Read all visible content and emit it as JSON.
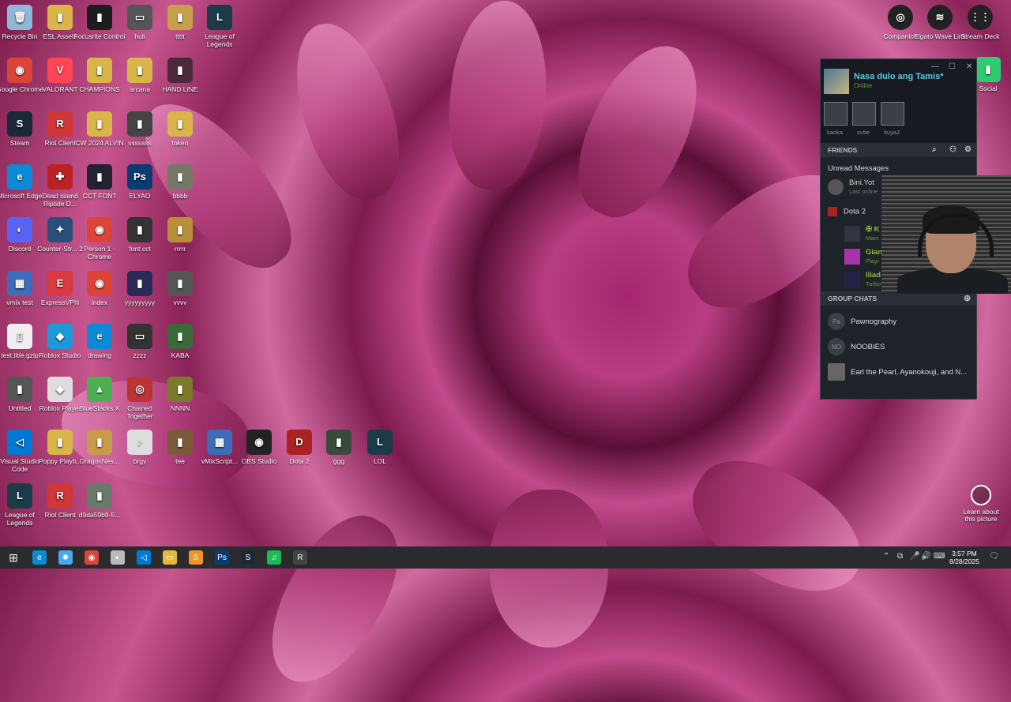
{
  "desktop": {
    "icons": [
      {
        "label": "Recycle Bin",
        "color": "#8fb7d8",
        "glyph": "🗑"
      },
      {
        "label": "ESL Assets",
        "color": "#d9b54a",
        "glyph": "▮"
      },
      {
        "label": "Focusrite Control",
        "color": "#1d1d1d",
        "glyph": "▮"
      },
      {
        "label": "huli",
        "color": "#555",
        "glyph": "▭"
      },
      {
        "label": "ttttt",
        "color": "#c9a04a",
        "glyph": "▮"
      },
      {
        "label": "League of Legends",
        "color": "#1b3b4a",
        "glyph": "L"
      },
      {
        "label": "Google Chrome",
        "color": "#db4437",
        "glyph": "◉"
      },
      {
        "label": "VALORANT",
        "color": "#ff4655",
        "glyph": "V"
      },
      {
        "label": "CHAMPIONS",
        "color": "#d9b54a",
        "glyph": "▮"
      },
      {
        "label": "arcana",
        "color": "#d9b54a",
        "glyph": "▮"
      },
      {
        "label": "HAND LINE",
        "color": "#4a2a3a",
        "glyph": "▮"
      },
      {
        "label": "Steam",
        "color": "#1b2838",
        "glyph": "S"
      },
      {
        "label": "Riot Client",
        "color": "#d13639",
        "glyph": "R"
      },
      {
        "label": "CW 2024 ALVIN",
        "color": "#d9b54a",
        "glyph": "▮"
      },
      {
        "label": "sssssss",
        "color": "#444",
        "glyph": "▮"
      },
      {
        "label": "token",
        "color": "#d9b54a",
        "glyph": "▮"
      },
      {
        "label": "Microsoft Edge",
        "color": "#0c8ad6",
        "glyph": "e"
      },
      {
        "label": "Dead Island Riptide D...",
        "color": "#b22",
        "glyph": "✚"
      },
      {
        "label": "CCT FONT",
        "color": "#223",
        "glyph": "▮"
      },
      {
        "label": "ELYAO",
        "color": "#0b3b73",
        "glyph": "Ps"
      },
      {
        "label": "bbbb",
        "color": "#776",
        "glyph": "▮"
      },
      {
        "label": "Discord",
        "color": "#5865f2",
        "glyph": "◐"
      },
      {
        "label": "Counter-Str... 2",
        "color": "#2a4f7a",
        "glyph": "✦"
      },
      {
        "label": "Person 1 - Chrome",
        "color": "#db4437",
        "glyph": "◉"
      },
      {
        "label": "font cct",
        "color": "#333",
        "glyph": "▮"
      },
      {
        "label": "rrrrr",
        "color": "#b8903a",
        "glyph": "▮"
      },
      {
        "label": "vmix test",
        "color": "#3b6db8",
        "glyph": "▦"
      },
      {
        "label": "ExpressVPN",
        "color": "#da3940",
        "glyph": "E"
      },
      {
        "label": "index",
        "color": "#db4437",
        "glyph": "◉"
      },
      {
        "label": "yyyyyyyyy",
        "color": "#2a2a5a",
        "glyph": "▮"
      },
      {
        "label": "vvvv",
        "color": "#555",
        "glyph": "▮"
      },
      {
        "label": "test.title.gzip",
        "color": "#eee",
        "glyph": "▯"
      },
      {
        "label": "Roblox Studio",
        "color": "#1a9ad9",
        "glyph": "◆"
      },
      {
        "label": "drawing",
        "color": "#0c8ad6",
        "glyph": "e"
      },
      {
        "label": "zzzz",
        "color": "#333",
        "glyph": "▭"
      },
      {
        "label": "KABA",
        "color": "#3a6a3a",
        "glyph": "▮"
      },
      {
        "label": "Untitled",
        "color": "#555",
        "glyph": "▮"
      },
      {
        "label": "Roblox Player",
        "color": "#ddd",
        "glyph": "◆"
      },
      {
        "label": "BlueStacks X",
        "color": "#4caf50",
        "glyph": "▲"
      },
      {
        "label": "Chained Together",
        "color": "#b33",
        "glyph": "◎"
      },
      {
        "label": "NNNN",
        "color": "#7a7a2a",
        "glyph": "▮"
      },
      {
        "label": "Visual Studio Code",
        "color": "#0078d4",
        "glyph": "◁"
      },
      {
        "label": "Poppy Playti...",
        "color": "#d9b54a",
        "glyph": "▮"
      },
      {
        "label": "DragonNes...",
        "color": "#c89a4a",
        "glyph": "▮"
      },
      {
        "label": "brgy",
        "color": "#ddd",
        "glyph": "♪"
      },
      {
        "label": "tee",
        "color": "#7a5a3a",
        "glyph": "▮"
      },
      {
        "label": "vMixScript...",
        "color": "#3b6db8",
        "glyph": "▦"
      },
      {
        "label": "OBS Studio",
        "color": "#222",
        "glyph": "◉"
      },
      {
        "label": "Dota 2",
        "color": "#a22",
        "glyph": "D"
      },
      {
        "label": "ggg",
        "color": "#3a4a3a",
        "glyph": "▮"
      },
      {
        "label": "LOL",
        "color": "#1b3b4a",
        "glyph": "L"
      },
      {
        "label": "League of Legends",
        "color": "#1b3b4a",
        "glyph": "L"
      },
      {
        "label": "Riot Client",
        "color": "#d13639",
        "glyph": "R"
      },
      {
        "label": "d9da59b9-5...",
        "color": "#6a7a6a",
        "glyph": "▮"
      }
    ],
    "right_icons": [
      {
        "label": "Companion",
        "glyph": "◎"
      },
      {
        "label": "Elgato Wave Link",
        "glyph": "≋"
      },
      {
        "label": "Stream Deck",
        "glyph": "⋮⋮"
      },
      {
        "label": "Social",
        "glyph": "▮"
      }
    ],
    "learn_label": "Learn about this picture"
  },
  "friends": {
    "username": "Nasa dulo ang Tamis*",
    "status": "Online",
    "window_buttons": [
      "—",
      "☐",
      "✕"
    ],
    "party": [
      "kaoka",
      "cutie",
      "kuyaJ"
    ],
    "friends_header": "FRIENDS",
    "unread_label": "Unread Messages",
    "unread_friend": {
      "name": "Bini.Yot",
      "sub": "Last online"
    },
    "game_group": "Dota 2",
    "game_friends": [
      {
        "name": "✠ K",
        "sub": "Main"
      },
      {
        "name": "Gian",
        "sub": "Playi"
      },
      {
        "name": "Iliad",
        "sub": "Turbo"
      }
    ],
    "group_chats_header": "GROUP CHATS",
    "group_chats": [
      {
        "initials": "Pa",
        "name": "Pawnography"
      },
      {
        "initials": "NO",
        "name": "NOOBIES"
      },
      {
        "initials": "",
        "name": "Earl the Pearl, Ayanokouji, and N..."
      }
    ]
  },
  "taskbar": {
    "apps": [
      {
        "name": "edge",
        "glyph": "e",
        "color": "#0c8ad6"
      },
      {
        "name": "copilot",
        "glyph": "✺",
        "color": "#4aa8e8"
      },
      {
        "name": "chrome",
        "glyph": "◉",
        "color": "#db4437"
      },
      {
        "name": "app-white",
        "glyph": "◐",
        "color": "#bbb"
      },
      {
        "name": "vscode",
        "glyph": "◁",
        "color": "#0078d4"
      },
      {
        "name": "explorer",
        "glyph": "▭",
        "color": "#e8b83a"
      },
      {
        "name": "sublime",
        "glyph": "S",
        "color": "#f0932b"
      },
      {
        "name": "photoshop",
        "glyph": "Ps",
        "color": "#0b3b73"
      },
      {
        "name": "steam",
        "glyph": "S",
        "color": "#1b2838"
      },
      {
        "name": "spotify",
        "glyph": "♫",
        "color": "#1db954"
      },
      {
        "name": "riot",
        "glyph": "R",
        "color": "#444"
      }
    ],
    "time": "3:57 PM",
    "date": "8/28/2025"
  }
}
